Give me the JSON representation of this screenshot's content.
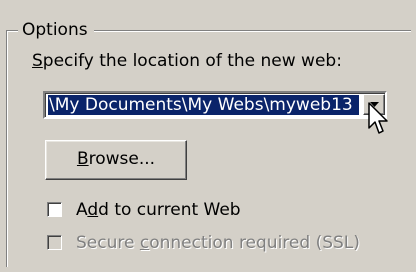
{
  "options": {
    "group_title": "Options",
    "location_label_key": "S",
    "location_label_rest": "pecify the location of the new web:",
    "location_value": "\\My Documents\\My Webs\\myweb13",
    "browse_key": "B",
    "browse_rest": "rowse...",
    "add_pre": "A",
    "add_key": "d",
    "add_rest": "d to current Web",
    "add_checked": false,
    "secure_pre": "Secure ",
    "secure_key": "c",
    "secure_rest": "onnection required (SSL)",
    "secure_checked": false,
    "secure_enabled": false
  },
  "icons": {
    "dropdown": "chevron-down-icon",
    "cursor": "mouse-pointer-icon"
  }
}
